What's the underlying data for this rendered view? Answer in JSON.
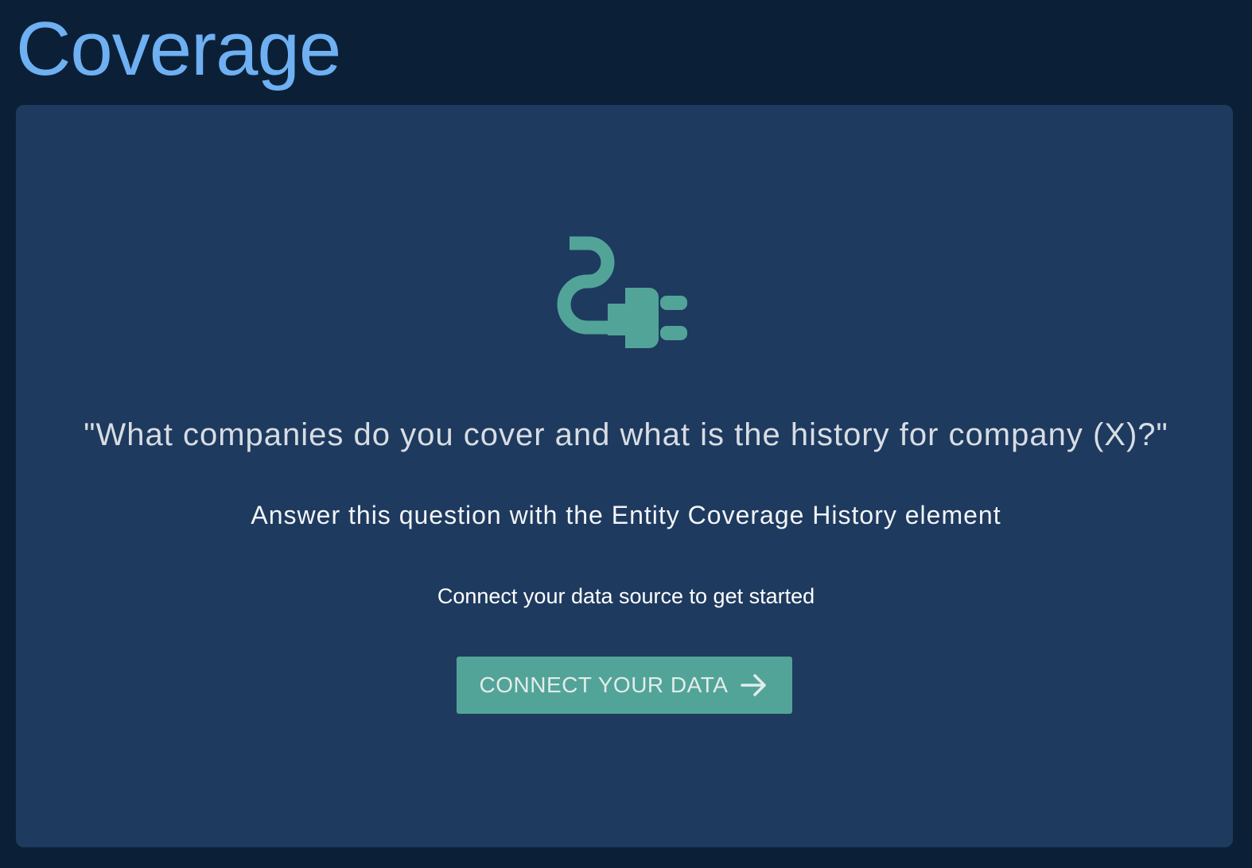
{
  "page": {
    "title": "Coverage"
  },
  "empty_state": {
    "icon": "plug-icon",
    "question": "\"What companies do you cover and what is the history for company (X)?\"",
    "subtitle": "Answer this question with the Entity Coverage History element",
    "hint": "Connect your data source to get started",
    "button_label": "CONNECT YOUR DATA",
    "button_icon": "arrow-right-icon"
  },
  "colors": {
    "background": "#0b2037",
    "panel": "#1e3a5f",
    "title": "#6eb0f2",
    "accent": "#52a499"
  }
}
